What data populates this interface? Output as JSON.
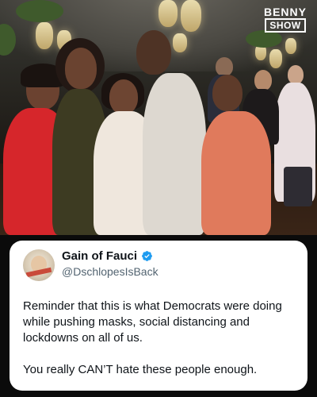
{
  "watermark": {
    "line1": "BENNY",
    "line2": "SHOW"
  },
  "tweet": {
    "display_name": "Gain of Fauci",
    "handle": "@DschlopesIsBack",
    "paragraph1": "Reminder that this is what Democrats were doing while pushing masks, social distancing and lockdowns on all of us.",
    "paragraph2": "You really CAN’T hate these people enough."
  },
  "icons": {
    "verified": "verified-badge-icon",
    "avatar": "profile-avatar-icon"
  },
  "colors": {
    "verified_blue": "#1d9bf0",
    "text_primary": "#0f1419",
    "text_secondary": "#536471",
    "page_background": "#0b0b0b",
    "card_background": "#ffffff"
  }
}
